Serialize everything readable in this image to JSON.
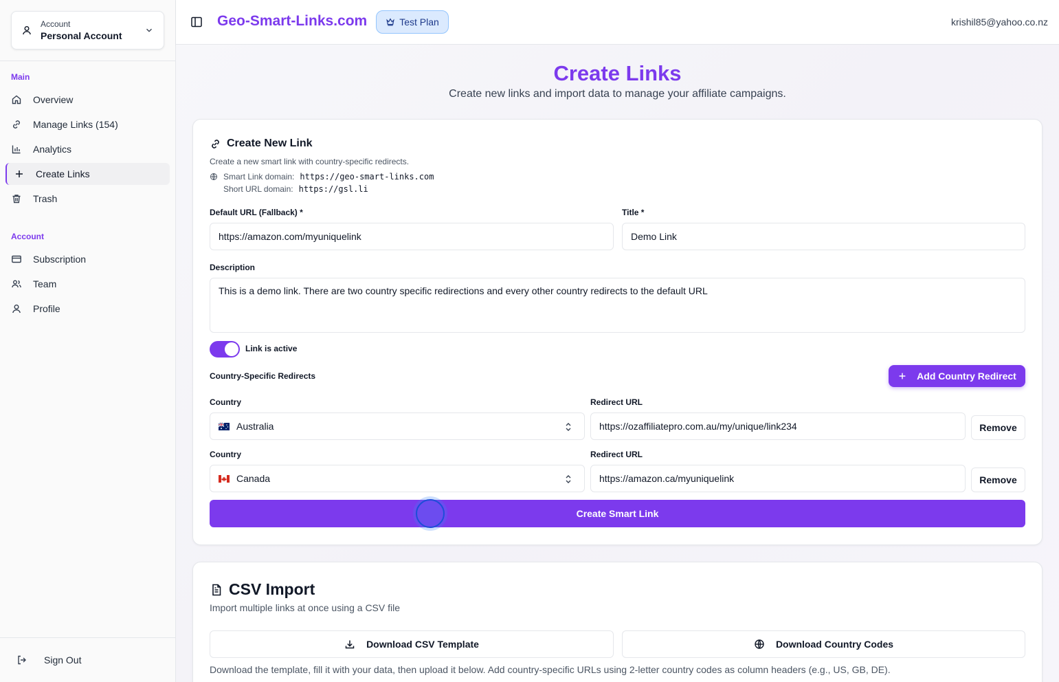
{
  "sidebar": {
    "account_label": "Account",
    "account_name": "Personal Account",
    "sections": {
      "main_label": "Main",
      "account_label": "Account"
    },
    "main_items": [
      {
        "label": "Overview",
        "icon": "home-icon"
      },
      {
        "label": "Manage Links (154)",
        "icon": "link-icon"
      },
      {
        "label": "Analytics",
        "icon": "bar-chart-icon"
      },
      {
        "label": "Create Links",
        "icon": "plus-icon",
        "active": true
      },
      {
        "label": "Trash",
        "icon": "trash-icon"
      }
    ],
    "account_items": [
      {
        "label": "Subscription",
        "icon": "credit-card-icon"
      },
      {
        "label": "Team",
        "icon": "users-icon"
      },
      {
        "label": "Profile",
        "icon": "user-icon"
      }
    ],
    "sign_out": "Sign Out"
  },
  "header": {
    "brand": "Geo-Smart-Links.com",
    "plan": "Test Plan",
    "email": "krishil85@yahoo.co.nz"
  },
  "page": {
    "title": "Create Links",
    "subtitle": "Create new links and import data to manage your affiliate campaigns."
  },
  "create_card": {
    "title": "Create New Link",
    "description": "Create a new smart link with country-specific redirects.",
    "smart_domain_label": "Smart Link domain:",
    "smart_domain_value": "https://geo-smart-links.com",
    "short_domain_label": "Short URL domain:",
    "short_domain_value": "https://gsl.li",
    "default_url_label": "Default URL (Fallback) *",
    "default_url_value": "https://amazon.com/myuniquelink",
    "title_label": "Title *",
    "title_value": "Demo Link",
    "description_label": "Description",
    "description_value": "This is a demo link. There are two country specific redirections and every other country redirects to the default URL",
    "active_label": "Link is active",
    "active": true,
    "redirects_label": "Country-Specific Redirects",
    "add_redirect_label": "Add Country Redirect",
    "country_label": "Country",
    "redirect_url_label": "Redirect URL",
    "remove_label": "Remove",
    "redirects": [
      {
        "country": "Australia",
        "url": "https://ozaffiliatepro.com.au/my/unique/link234"
      },
      {
        "country": "Canada",
        "url": "https://amazon.ca/myuniquelink"
      }
    ],
    "submit_label": "Create Smart Link"
  },
  "csv_card": {
    "title": "CSV Import",
    "description": "Import multiple links at once using a CSV file",
    "download_template": "Download CSV Template",
    "download_codes": "Download Country Codes",
    "note": "Download the template, fill it with your data, then upload it below. Add country-specific URLs using 2-letter country codes as column headers (e.g., US, GB, DE)."
  },
  "colors": {
    "accent": "#7c3aed",
    "badge_bg": "#dbeafe",
    "badge_border": "#93c5fd"
  }
}
